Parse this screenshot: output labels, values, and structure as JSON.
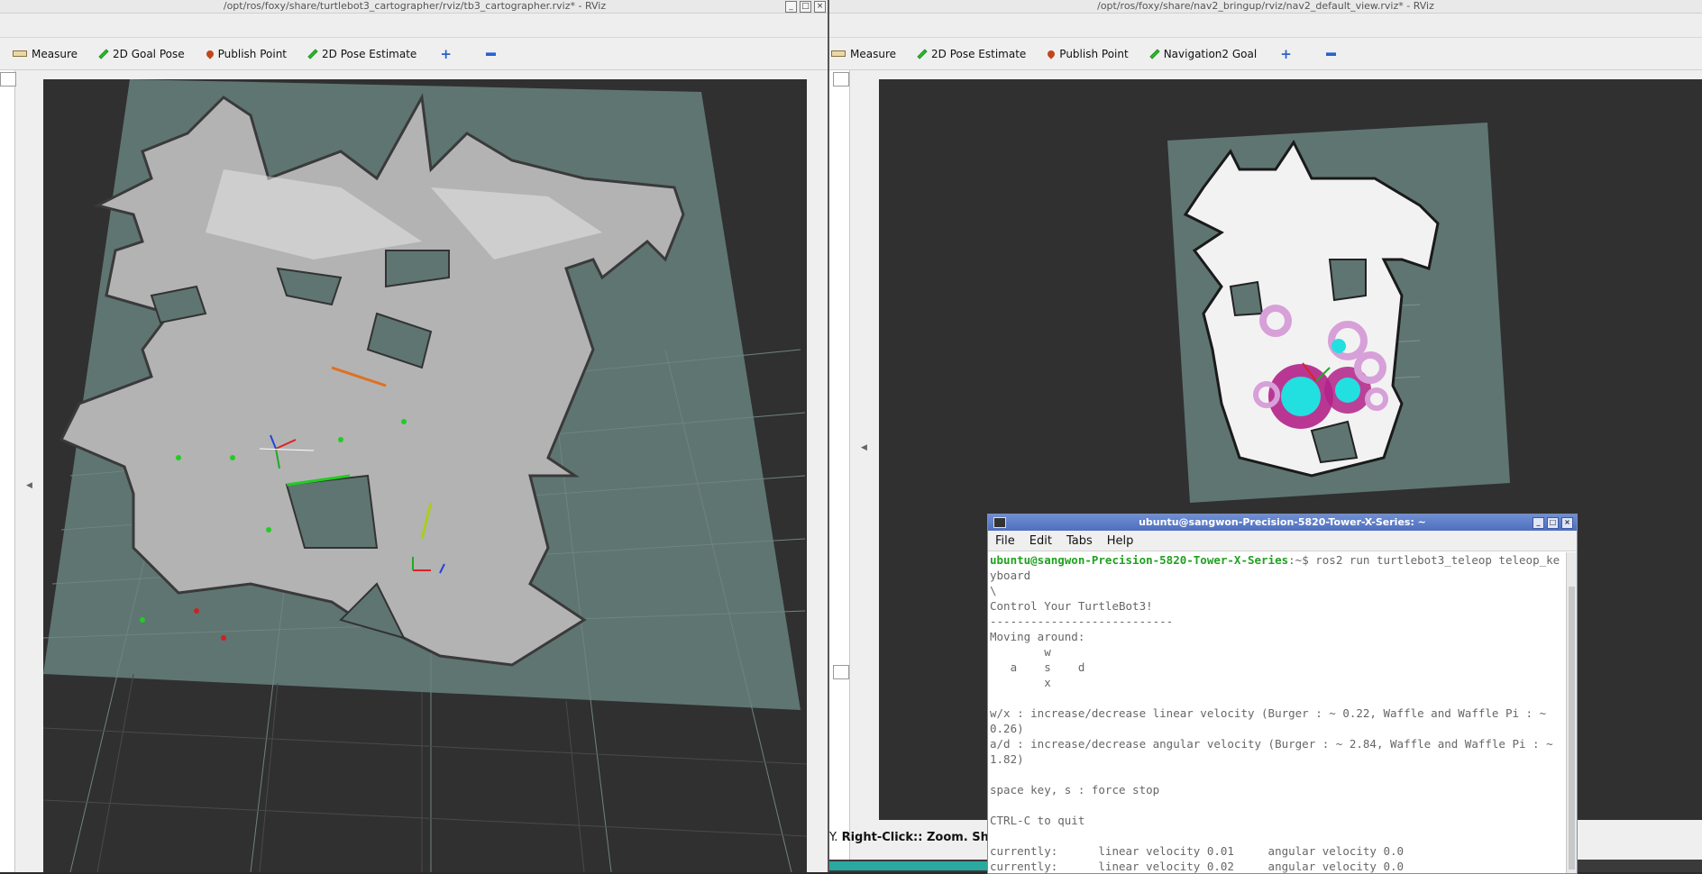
{
  "left_window": {
    "title": "/opt/ros/foxy/share/turtlebot3_cartographer/rviz/tb3_cartographer.rviz* - RViz",
    "tools": [
      {
        "icon": "ruler-icon",
        "label": "Measure"
      },
      {
        "icon": "green-arrow-icon",
        "label": "2D Goal Pose"
      },
      {
        "icon": "map-pin-icon",
        "label": "Publish Point"
      },
      {
        "icon": "green-arrow-icon",
        "label": "2D Pose Estimate"
      },
      {
        "icon": "plus-icon",
        "label": ""
      },
      {
        "icon": "minus-icon",
        "label": ""
      }
    ]
  },
  "right_window": {
    "title": "/opt/ros/foxy/share/nav2_bringup/rviz/nav2_default_view.rviz* - RViz",
    "tools": [
      {
        "icon": "ruler-icon",
        "label": "Measure"
      },
      {
        "icon": "green-arrow-icon",
        "label": "2D Pose Estimate"
      },
      {
        "icon": "map-pin-icon",
        "label": "Publish Point"
      },
      {
        "icon": "green-arrow-icon",
        "label": "Navigation2 Goal"
      },
      {
        "icon": "plus-icon",
        "label": ""
      },
      {
        "icon": "minus-icon",
        "label": ""
      }
    ],
    "status_prefix": "Y.",
    "status_bold": "Right-Click:",
    "status_rest": ": Zoom. Sh"
  },
  "terminal": {
    "title": "ubuntu@sangwon-Precision-5820-Tower-X-Series: ~",
    "menu": [
      "File",
      "Edit",
      "Tabs",
      "Help"
    ],
    "prompt_user": "ubuntu@sangwon-Precision-5820-Tower-X-Series",
    "prompt_rest": ":~$ ros2 run turtlebot3_teleop teleop_keyboard",
    "lines": [
      "\\",
      "Control Your TurtleBot3!",
      "---------------------------",
      "Moving around:",
      "        w",
      "   a    s    d",
      "        x",
      "",
      "w/x : increase/decrease linear velocity (Burger : ~ 0.22, Waffle and Waffle Pi : ~ 0.26)",
      "a/d : increase/decrease angular velocity (Burger : ~ 2.84, Waffle and Waffle Pi : ~ 1.82)",
      "",
      "space key, s : force stop",
      "",
      "CTRL-C to quit",
      "",
      "currently:      linear velocity 0.01     angular velocity 0.0",
      "currently:      linear velocity 0.02     angular velocity 0.0"
    ]
  },
  "colors": {
    "map_plane": "#5f7572",
    "viewport_bg": "#303030",
    "free_space": "#b8b8b8",
    "costmap_cyan": "#22e0e0",
    "costmap_magenta": "#b0228a"
  }
}
